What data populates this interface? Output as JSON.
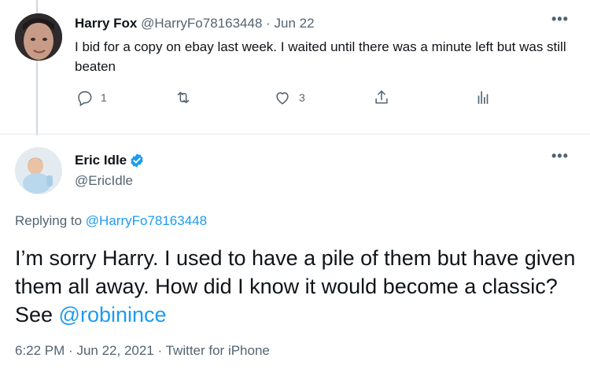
{
  "reply_tweet": {
    "name": "Harry Fox",
    "handle": "@HarryFo78163448",
    "separator": "·",
    "date": "Jun 22",
    "text": "I bid for a copy on ebay last week. I waited  until there was a minute left but was still beaten",
    "more": "•••",
    "actions": {
      "reply_count": "1",
      "retweet_count": "",
      "like_count": "3"
    }
  },
  "main_tweet": {
    "name": "Eric Idle",
    "handle": "@EricIdle",
    "more": "•••",
    "replying_prefix": "Replying to",
    "replying_handle": "@HarryFo78163448",
    "text_before_mention": "I’m sorry Harry.  I used to have a pile of them but have given them all away.  How did I know it would become a classic?  See ",
    "mention": "@robinince",
    "time": "6:22 PM",
    "separator": "·",
    "date": "Jun 22, 2021",
    "separator2": "·",
    "source": "Twitter for iPhone"
  },
  "colors": {
    "accent": "#1d9bf0",
    "text": "#0f1419",
    "muted": "#536471",
    "divider": "#e6ecf0"
  },
  "icons": [
    "reply-icon",
    "retweet-icon",
    "like-icon",
    "share-icon",
    "analytics-icon",
    "verified-badge-icon",
    "more-options-icon"
  ]
}
